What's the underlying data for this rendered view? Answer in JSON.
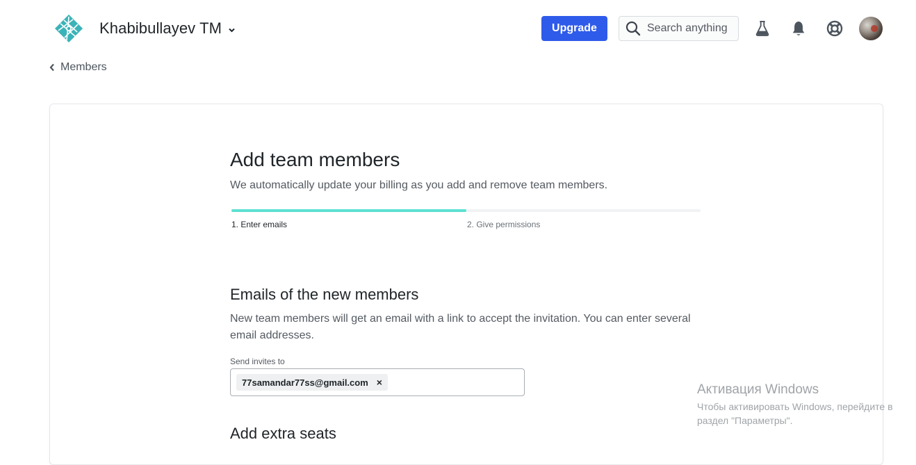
{
  "header": {
    "team_name": "Khabibullayev TM",
    "upgrade_label": "Upgrade",
    "search_placeholder": "Search anything",
    "icons": [
      "netlify-logo-icon",
      "chevron-down-icon",
      "search-icon",
      "flask-icon",
      "bell-icon",
      "lifebuoy-icon",
      "avatar"
    ]
  },
  "breadcrumb": {
    "back_label": "Members"
  },
  "main": {
    "title": "Add team members",
    "subtitle": "We automatically update your billing as you add and remove team members.",
    "progress_fraction": 0.5,
    "steps": [
      "1. Enter emails",
      "2. Give permissions"
    ],
    "emails_section": {
      "title": "Emails of the new members",
      "description": "New team members will get an email with a link to accept the invitation. You can enter several email addresses.",
      "field_label": "Send invites to",
      "chips": [
        "77samandar77ss@gmail.com"
      ],
      "chip_remove": "×"
    },
    "next_section_title": "Add extra seats"
  },
  "os_overlay": {
    "title": "Активация Windows",
    "text": "Чтобы активировать Windows, перейдите в раздел \"Параметры\"."
  },
  "colors": {
    "accent": "#2f5bea",
    "progress": "#5ee0d2",
    "logo": "#3bb3b8"
  }
}
